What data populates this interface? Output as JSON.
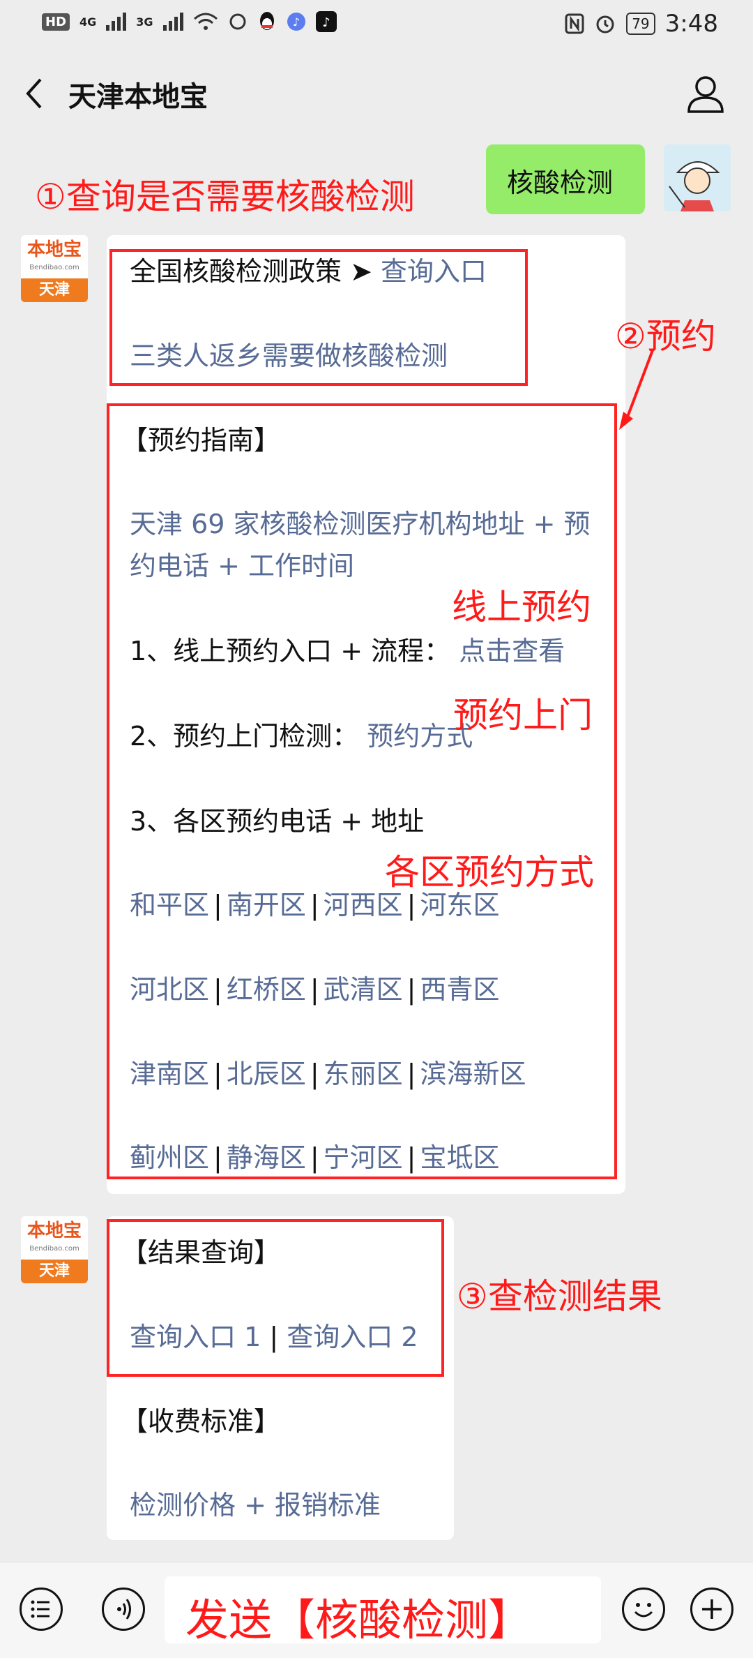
{
  "status": {
    "left_chip": "HD",
    "net1": "4G",
    "net2": "3G",
    "battery": "79",
    "time": "3:48"
  },
  "header": {
    "title": "天津本地宝"
  },
  "annotations": {
    "query": "①查询是否需要核酸检测",
    "reserve": "②预约",
    "online": "线上预约",
    "door": "预约上门",
    "district": "各区预约方式",
    "result": "③查检测结果",
    "send": "发送【核酸检测】"
  },
  "user_message": {
    "text": "核酸检测"
  },
  "bot_avatar": {
    "top": "本地宝",
    "sub": "Bendibao.com",
    "bottom": "天津"
  },
  "message1": {
    "policy_label": "全国核酸检测政策 ➤",
    "policy_link": "查询入口",
    "return_link": "三类人返乡需要做核酸检测",
    "guide_title": "【预约指南】",
    "institutions_line1": "天津 69 家核酸检测医疗机构地址 + 预",
    "institutions_line2": "约电话 + 工作时间",
    "online_label": "1、线上预约入口 + 流程：",
    "online_link": "点击查看",
    "door_label": "2、预约上门检测：",
    "door_link": "预约方式",
    "district_label": "3、各区预约电话 + 地址",
    "districts": [
      [
        "和平区",
        "南开区",
        "河西区",
        "河东区"
      ],
      [
        "河北区",
        "红桥区",
        "武清区",
        "西青区"
      ],
      [
        "津南区",
        "北辰区",
        "东丽区",
        "滨海新区"
      ],
      [
        "蓟州区",
        "静海区",
        "宁河区",
        "宝坻区"
      ]
    ],
    "separator": "|"
  },
  "message2": {
    "result_title": "【结果查询】",
    "result_link1": "查询入口 1",
    "result_link2": "查询入口 2",
    "fee_title": "【收费标准】",
    "fee_link": "检测价格 + 报销标准"
  },
  "icons": {
    "back": "chevron-left-icon",
    "user": "user-icon",
    "list": "list-icon",
    "voice": "voice-icon",
    "emoji": "emoji-icon",
    "plus": "plus-icon"
  },
  "colors": {
    "link": "#576b95",
    "annotation": "#ff1a1a",
    "user_bubble": "#95ec69",
    "background": "#ededed"
  }
}
